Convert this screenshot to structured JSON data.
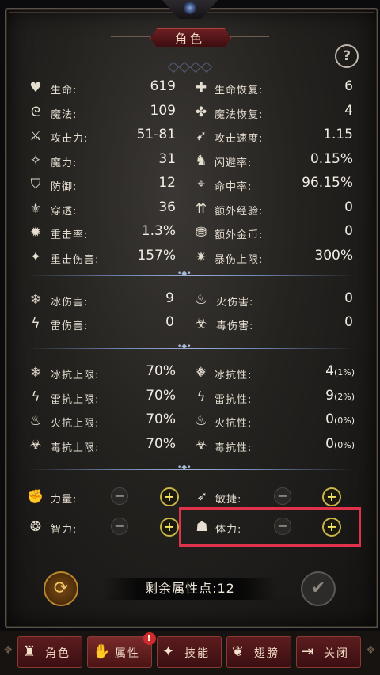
{
  "header": {
    "title": "角色",
    "help_label": "?"
  },
  "base_stats": [
    {
      "icon": "heart-icon",
      "glyph": "♥",
      "label": "生命:",
      "value": "619"
    },
    {
      "icon": "swirl-magic-icon",
      "glyph": "ᘓ",
      "label": "魔法:",
      "value": "109"
    },
    {
      "icon": "sword-icon",
      "glyph": "⚔",
      "label": "攻击力:",
      "value": "51-81"
    },
    {
      "icon": "magic-wand-icon",
      "glyph": "✧",
      "label": "魔力:",
      "value": "31"
    },
    {
      "icon": "shield-icon",
      "glyph": "⛉",
      "label": "防御:",
      "value": "12"
    },
    {
      "icon": "pierce-icon",
      "glyph": "⚜",
      "label": "穿透:",
      "value": "36"
    },
    {
      "icon": "heavy-strike-icon",
      "glyph": "✹",
      "label": "重击率:",
      "value": "1.3%"
    },
    {
      "icon": "heavy-damage-icon",
      "glyph": "✦",
      "label": "重击伤害:",
      "value": "157%"
    }
  ],
  "secondary_stats": [
    {
      "icon": "life-regen-icon",
      "glyph": "✚",
      "label": "生命恢复:",
      "value": "6"
    },
    {
      "icon": "mana-regen-icon",
      "glyph": "✤",
      "label": "魔法恢复:",
      "value": "4"
    },
    {
      "icon": "attack-speed-icon",
      "glyph": "➹",
      "label": "攻击速度:",
      "value": "1.15"
    },
    {
      "icon": "dodge-icon",
      "glyph": "♞",
      "label": "闪避率:",
      "value": "0.15%"
    },
    {
      "icon": "accuracy-icon",
      "glyph": "⌖",
      "label": "命中率:",
      "value": "96.15%"
    },
    {
      "icon": "extra-exp-icon",
      "glyph": "⇈",
      "label": "额外经验:",
      "value": "0"
    },
    {
      "icon": "extra-gold-icon",
      "glyph": "⛃",
      "label": "额外金币:",
      "value": "0"
    },
    {
      "icon": "crit-cap-icon",
      "glyph": "✷",
      "label": "暴伤上限:",
      "value": "300%"
    }
  ],
  "elemental_damage": [
    {
      "icon": "ice-icon",
      "glyph": "❄",
      "label": "冰伤害:",
      "value": "9"
    },
    {
      "icon": "lightning-icon",
      "glyph": "ϟ",
      "label": "雷伤害:",
      "value": "0"
    },
    {
      "icon": "fire-icon",
      "glyph": "♨",
      "label": "火伤害:",
      "value": "0"
    },
    {
      "icon": "poison-icon",
      "glyph": "☣",
      "label": "毒伤害:",
      "value": "0"
    }
  ],
  "resist_caps": [
    {
      "icon": "ice-resist-cap-icon",
      "glyph": "❄",
      "label": "冰抗上限:",
      "value": "70%"
    },
    {
      "icon": "lightning-resist-cap-icon",
      "glyph": "ϟ",
      "label": "雷抗上限:",
      "value": "70%"
    },
    {
      "icon": "fire-resist-cap-icon",
      "glyph": "♨",
      "label": "火抗上限:",
      "value": "70%"
    },
    {
      "icon": "poison-resist-cap-icon",
      "glyph": "☣",
      "label": "毒抗上限:",
      "value": "70%"
    }
  ],
  "resists": [
    {
      "icon": "ice-resist-icon",
      "glyph": "❅",
      "label": "冰抗性:",
      "value": "4",
      "percent": "(1%)"
    },
    {
      "icon": "lightning-resist-icon",
      "glyph": "ϟ",
      "label": "雷抗性:",
      "value": "9",
      "percent": "(2%)"
    },
    {
      "icon": "fire-resist-icon",
      "glyph": "♨",
      "label": "火抗性:",
      "value": "0",
      "percent": "(0%)"
    },
    {
      "icon": "poison-resist-icon",
      "glyph": "☣",
      "label": "毒抗性:",
      "value": "0",
      "percent": "(0%)"
    }
  ],
  "attributes": {
    "strength": {
      "label": "力量:"
    },
    "agility": {
      "label": "敏捷:"
    },
    "intelligence": {
      "label": "智力:"
    },
    "stamina": {
      "label": "体力:"
    },
    "minus": "−",
    "plus": "+"
  },
  "remaining_points": "剩余属性点:12",
  "tabs": [
    {
      "label": "角色",
      "glyph": "♜"
    },
    {
      "label": "属性",
      "glyph": "✋",
      "badge": "!"
    },
    {
      "label": "技能",
      "glyph": "✦"
    },
    {
      "label": "翅膀",
      "glyph": "❦"
    },
    {
      "label": "关闭",
      "glyph": "⇥"
    }
  ]
}
